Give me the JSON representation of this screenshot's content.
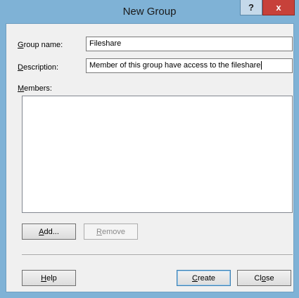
{
  "window": {
    "title": "New Group",
    "help_glyph": "?",
    "close_glyph": "x"
  },
  "form": {
    "group_name": {
      "label_first": "G",
      "label_rest": "roup name:",
      "value": "Fileshare"
    },
    "description": {
      "label_first": "D",
      "label_rest": "escription:",
      "value": "Member of this group have access to the fileshare"
    },
    "members": {
      "label_first": "M",
      "label_rest": "embers:"
    }
  },
  "buttons": {
    "add": {
      "first": "A",
      "rest": "dd..."
    },
    "remove": {
      "first": "R",
      "rest": "emove"
    },
    "help": {
      "first": "H",
      "rest": "elp"
    },
    "create": {
      "first": "C",
      "rest": "reate"
    },
    "close": {
      "pre": "Cl",
      "mid": "o",
      "post": "se"
    }
  }
}
